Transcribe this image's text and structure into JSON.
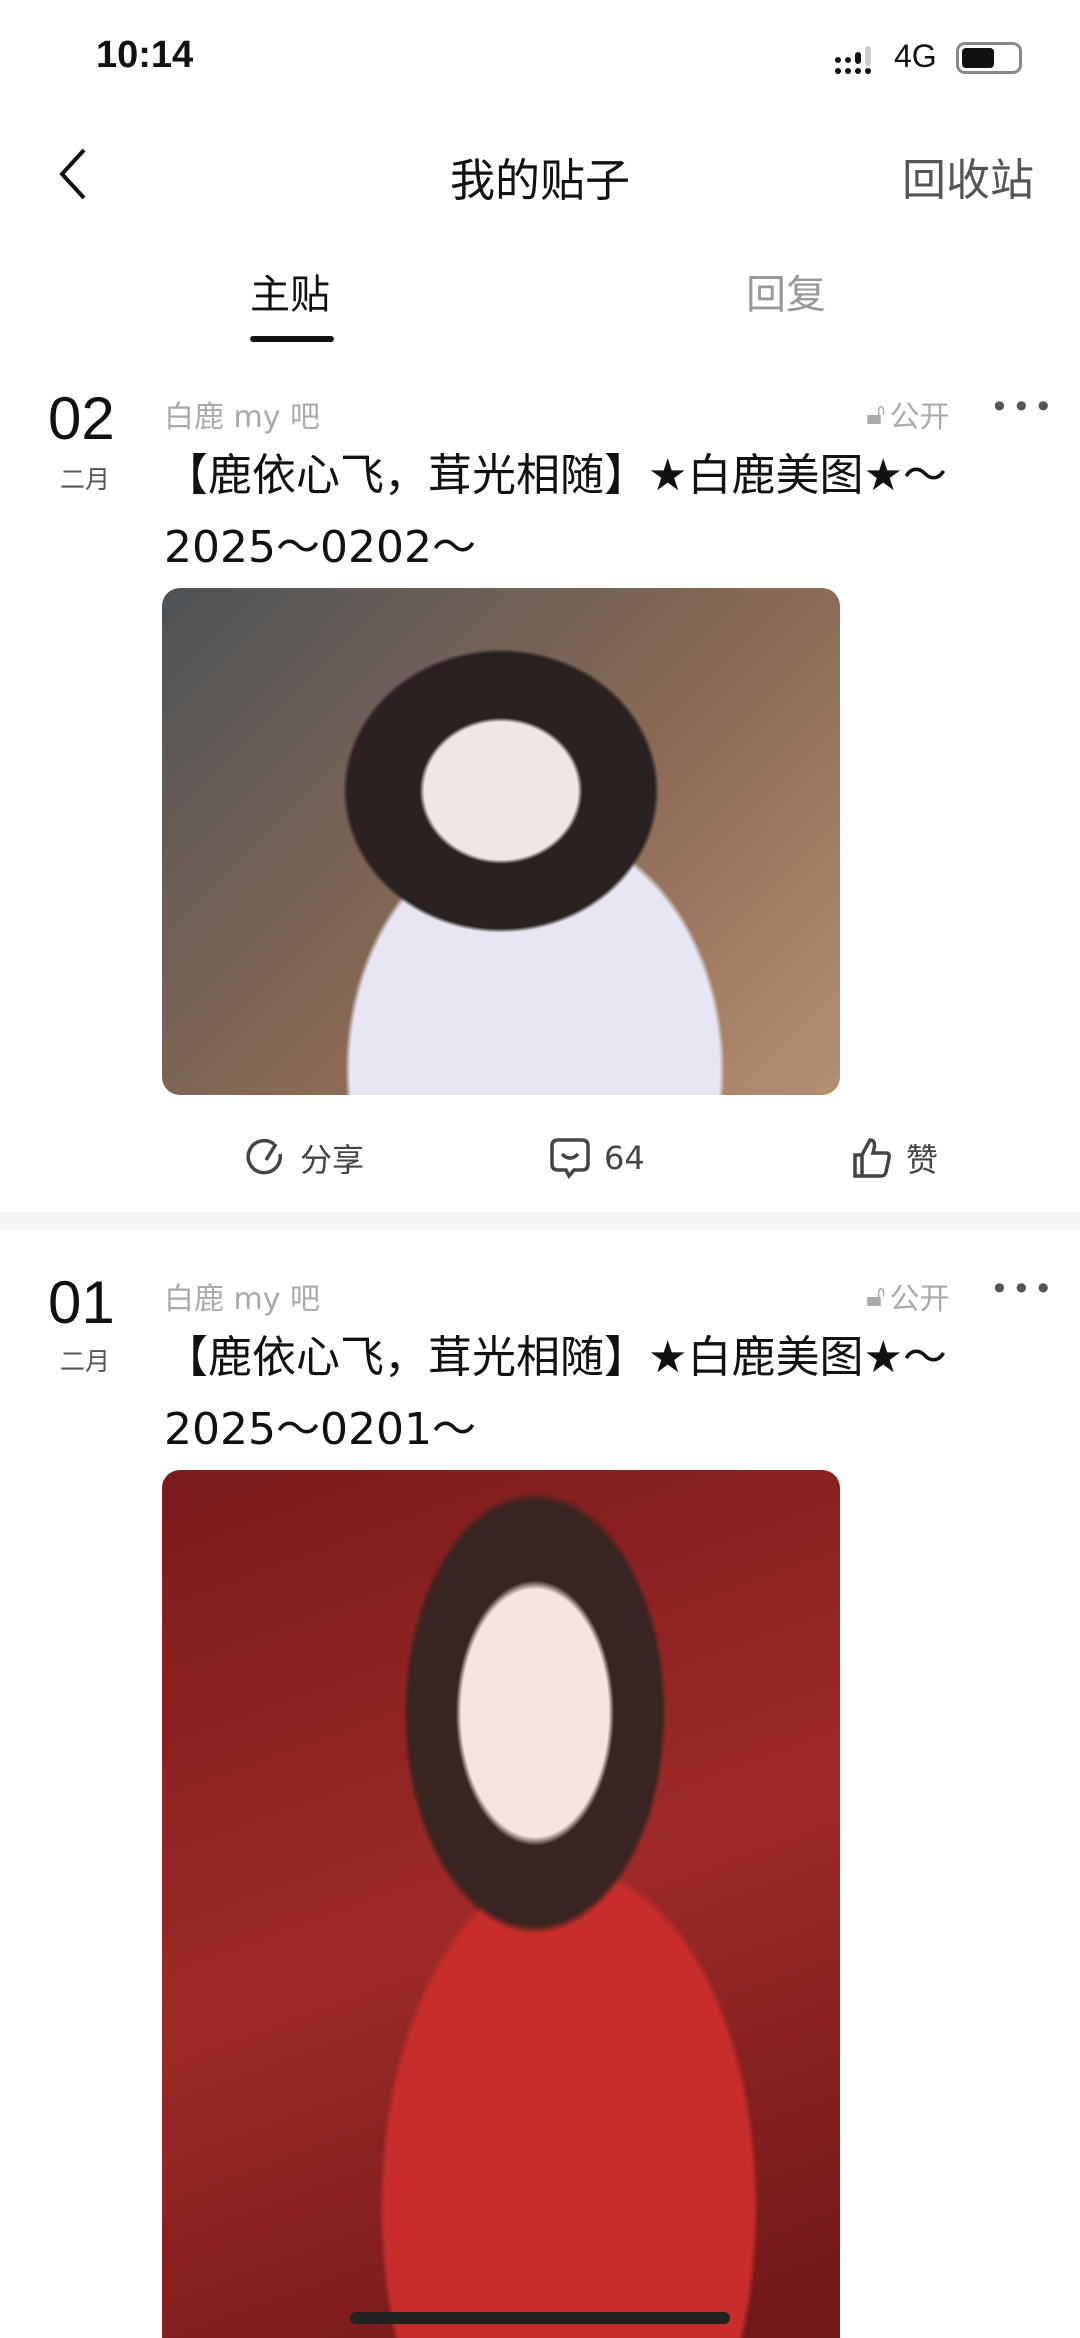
{
  "status": {
    "time": "10:14",
    "network": "4G"
  },
  "nav": {
    "title": "我的贴子",
    "recycle": "回收站"
  },
  "tabs": [
    {
      "label": "主贴",
      "active": true
    },
    {
      "label": "回复",
      "active": false
    }
  ],
  "posts": [
    {
      "day": "02",
      "month": "二月",
      "forum": "白鹿 my 吧",
      "visibility": "公开",
      "title": "【鹿依心飞，茸光相随】★白鹿美图★～2025～0202～",
      "share": "分享",
      "comments": "64",
      "like": "赞"
    },
    {
      "day": "01",
      "month": "二月",
      "forum": "白鹿 my 吧",
      "visibility": "公开",
      "title": "【鹿依心飞，茸光相随】★白鹿美图★～2025～0201～"
    }
  ]
}
